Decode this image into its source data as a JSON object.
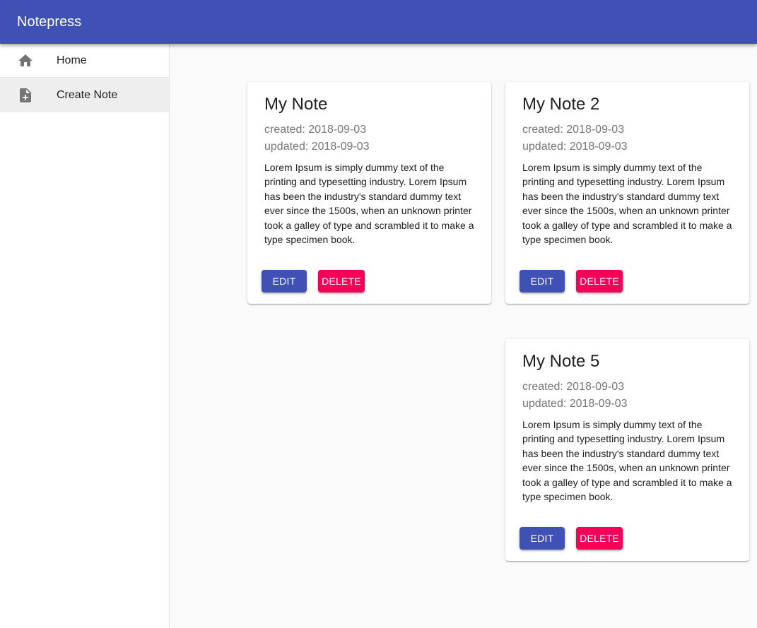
{
  "app": {
    "title": "Notepress"
  },
  "colors": {
    "primary": "#3f51b5",
    "secondary": "#f50057",
    "background": "#fafafa"
  },
  "nav": {
    "items": [
      {
        "label": "Home",
        "icon": "home-icon",
        "active": false
      },
      {
        "label": "Create Note",
        "icon": "note-add-icon",
        "active": true
      }
    ]
  },
  "notes": [
    {
      "title": "My Note",
      "created": "created: 2018-09-03",
      "updated": "updated: 2018-09-03",
      "body": "Lorem Ipsum is simply dummy text of the printing and typesetting industry. Lorem Ipsum has been the industry's standard dummy text ever since the 1500s, when an unknown printer took a galley of type and scrambled it to make a type specimen book.",
      "edit_label": "EDIT",
      "delete_label": "DELETE"
    },
    {
      "title": "My Note 2",
      "created": "created: 2018-09-03",
      "updated": "updated: 2018-09-03",
      "body": "Lorem Ipsum is simply dummy text of the printing and typesetting industry. Lorem Ipsum has been the industry's standard dummy text ever since the 1500s, when an unknown printer took a galley of type and scrambled it to make a type specimen book.",
      "edit_label": "EDIT",
      "delete_label": "DELETE"
    },
    {
      "title": "My Note 5",
      "created": "created: 2018-09-03",
      "updated": "updated: 2018-09-03",
      "body": "Lorem Ipsum is simply dummy text of the printing and typesetting industry. Lorem Ipsum has been the industry's standard dummy text ever since the 1500s, when an unknown printer took a galley of type and scrambled it to make a type specimen book.",
      "edit_label": "EDIT",
      "delete_label": "DELETE"
    }
  ]
}
